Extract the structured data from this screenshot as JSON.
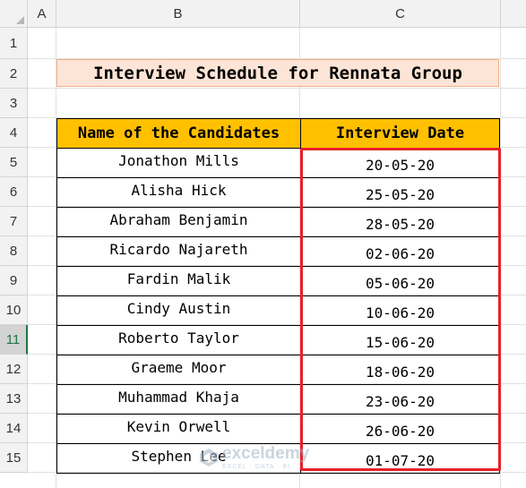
{
  "columns": [
    "A",
    "B",
    "C"
  ],
  "rows": [
    "1",
    "2",
    "3",
    "4",
    "5",
    "6",
    "7",
    "8",
    "9",
    "10",
    "11",
    "12",
    "13",
    "14",
    "15"
  ],
  "title": "Interview Schedule for Rennata Group",
  "table": {
    "headers": {
      "name": "Name of the Candidates",
      "date": "Interview Date"
    },
    "rows": [
      {
        "name": "Jonathon Mills",
        "date": "20-05-20"
      },
      {
        "name": "Alisha Hick",
        "date": "25-05-20"
      },
      {
        "name": "Abraham Benjamin",
        "date": "28-05-20"
      },
      {
        "name": "Ricardo Najareth",
        "date": "02-06-20"
      },
      {
        "name": "Fardin Malik",
        "date": "05-06-20"
      },
      {
        "name": "Cindy Austin",
        "date": "10-06-20"
      },
      {
        "name": "Roberto Taylor",
        "date": "15-06-20"
      },
      {
        "name": "Graeme Moor",
        "date": "18-06-20"
      },
      {
        "name": "Muhammad Khaja",
        "date": "23-06-20"
      },
      {
        "name": "Kevin Orwell",
        "date": "26-06-20"
      },
      {
        "name": "Stephen Lee",
        "date": "01-07-20"
      }
    ]
  },
  "active_row": "11",
  "watermark": {
    "brand": "exceldemy",
    "tagline": "EXCEL · DATA · BI"
  },
  "colors": {
    "header_fill": "#ffc000",
    "title_fill": "#fce4d6",
    "highlight": "#e8212a",
    "active": "#217346"
  }
}
